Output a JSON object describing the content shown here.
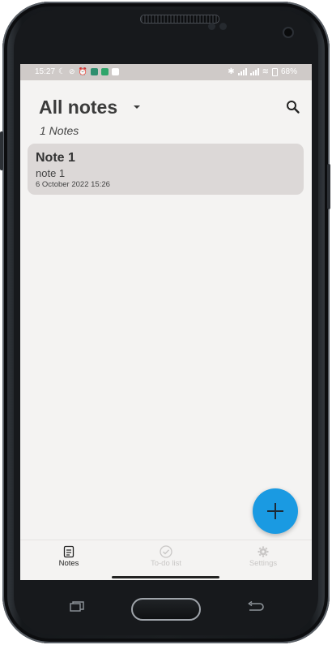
{
  "status_bar": {
    "time": "15:27",
    "battery": "68"
  },
  "header": {
    "title": "All notes",
    "note_count": "1 Notes"
  },
  "notes": [
    {
      "title": "Note 1",
      "body": "note 1",
      "date": "6 October 2022 15:26"
    }
  ],
  "bottom_nav": [
    {
      "label": "Notes",
      "icon": "notes-icon",
      "active": true
    },
    {
      "label": "To-do list",
      "icon": "check-circle-icon",
      "active": false
    },
    {
      "label": "Settings",
      "icon": "gear-icon",
      "active": false
    }
  ],
  "fab": {
    "icon": "plus-icon"
  },
  "colors": {
    "accent": "#1a9ae2",
    "card": "#dcd8d7",
    "background": "#f4f3f2",
    "status_bar": "#cfcac8"
  }
}
